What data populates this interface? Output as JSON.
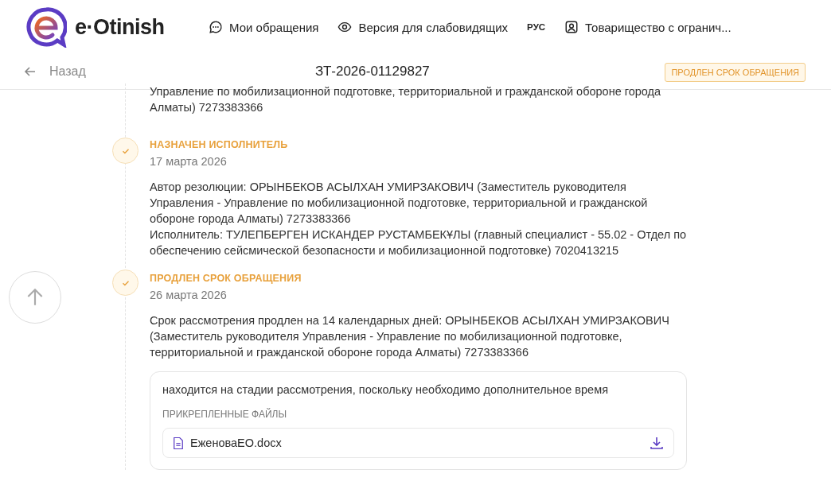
{
  "header": {
    "logo_text": "e·Otinish",
    "nav": [
      {
        "label": "Мои обращения"
      },
      {
        "label": "Версия для слабовидящих"
      },
      {
        "label": "РУС"
      },
      {
        "label": "Товарищество с огранич..."
      }
    ]
  },
  "subheader": {
    "back": "Назад",
    "number": "ЗТ-2026-01129827",
    "status": "ПРОДЛЕН СРОК ОБРАЩЕНИЯ"
  },
  "timeline": [
    {
      "lines": [
        "Управление по мобилизационной подготовке, территориальной и гражданской обороне города Алматы) 7273383366"
      ]
    },
    {
      "title": "НАЗНАЧЕН ИСПОЛНИТЕЛЬ",
      "date": "17 марта 2026",
      "lines": [
        "Автор резолюции: ОРЫНБЕКОВ АСЫЛХАН УМИРЗАКОВИЧ (Заместитель руководителя Управления - Управление по мобилизационной подготовке, территориальной и гражданской обороне города Алматы) 7273383366",
        "Исполнитель: ТУЛЕПБЕРГЕН ИСКАНДЕР РУСТАМБЕКҰЛЫ (главный специалист - 55.02 - Отдел по обеспечению сейсмической безопасности и мобилизационной подготовке) 7020413215"
      ],
      "done": true
    },
    {
      "title": "ПРОДЛЕН СРОК ОБРАЩЕНИЯ",
      "date": "26 марта 2026",
      "lines": [
        "Срок рассмотрения продлен на 14 календарных дней: ОРЫНБЕКОВ АСЫЛХАН УМИРЗАКОВИЧ (Заместитель руководителя Управления - Управление по мобилизационной подготовке, территориальной и гражданской обороне города Алматы) 7273383366"
      ],
      "done": true,
      "note": {
        "text": "находится на стадии рассмотрения, поскольку необходимо дополнительное время",
        "files_label": "ПРИКРЕПЛЕННЫЕ ФАЙЛЫ",
        "files": [
          "ЕженоваЕО.docx"
        ]
      }
    }
  ]
}
